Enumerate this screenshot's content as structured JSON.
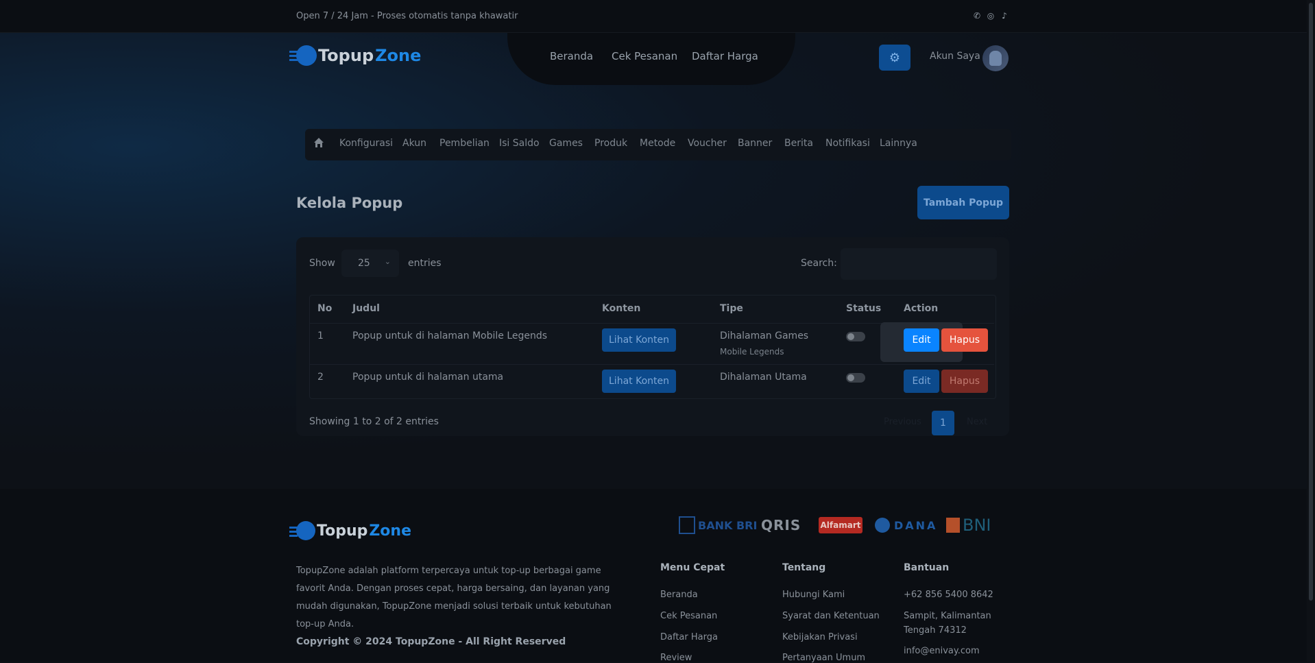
{
  "topbar": {
    "message": "Open 7 / 24 Jam - Proses otomatis tanpa khawatir",
    "socials": [
      "whatsapp-icon",
      "instagram-icon",
      "tiktok-icon"
    ]
  },
  "brand": {
    "name_part1": "Topup",
    "name_part2": "Zone"
  },
  "nav": {
    "home": "Beranda",
    "check_order": "Cek Pesanan",
    "price_list": "Daftar Harga"
  },
  "header": {
    "account": "Akun Saya"
  },
  "subnav": [
    "Konfigurasi",
    "Akun",
    "Pembelian",
    "Isi Saldo",
    "Games",
    "Produk",
    "Metode",
    "Voucher",
    "Banner",
    "Berita",
    "Notifikasi",
    "Lainnya"
  ],
  "page": {
    "title": "Kelola Popup",
    "add_button": "Tambah Popup"
  },
  "table_controls": {
    "show": "Show",
    "entries_value": "25",
    "entries": "entries",
    "search": "Search:"
  },
  "table": {
    "headers": [
      "No",
      "Judul",
      "Konten",
      "Tipe",
      "Status",
      "Action"
    ],
    "rows": [
      {
        "no": "1",
        "title": "Popup untuk di halaman Mobile Legends",
        "content_button": "Lihat Konten",
        "type": "Dihalaman Games",
        "type_sub": "Mobile Legends",
        "edit": "Edit",
        "delete": "Hapus"
      },
      {
        "no": "2",
        "title": "Popup untuk di halaman utama",
        "content_button": "Lihat Konten",
        "type": "Dihalaman Utama",
        "type_sub": "",
        "edit": "Edit",
        "delete": "Hapus"
      }
    ]
  },
  "pagination": {
    "summary": "Showing 1 to 2 of 2 entries",
    "previous": "Previous",
    "page": "1",
    "next": "Next"
  },
  "footer": {
    "payments": {
      "bri": "BANK BRI",
      "qris": "QRIS",
      "alfamart": "Alfamart",
      "dana": "DANA",
      "bni": "BNI"
    },
    "description": "TopupZone adalah platform terpercaya untuk top-up berbagai game favorit Anda. Dengan proses cepat, harga bersaing, dan layanan yang mudah digunakan, TopupZone menjadi solusi terbaik untuk kebutuhan top-up Anda.",
    "copyright": "Copyright © 2024 TopupZone - All Right Reserved",
    "quick_menu": {
      "title": "Menu Cepat",
      "links": [
        "Beranda",
        "Cek Pesanan",
        "Daftar Harga",
        "Review"
      ]
    },
    "about": {
      "title": "Tentang",
      "links": [
        "Hubungi Kami",
        "Syarat dan Ketentuan",
        "Kebijakan Privasi",
        "Pertanyaan Umum"
      ]
    },
    "help": {
      "title": "Bantuan",
      "phone": "+62 856 5400 8642",
      "address_line1": "Sampit, Kalimantan",
      "address_line2": "Tengah 74312",
      "email": "info@enivay.com"
    }
  },
  "colors": {
    "accent": "#0d4d92",
    "edit_active": "#0a84ff",
    "delete_active": "#e5533d",
    "delete_dim": "#7a2a24"
  }
}
